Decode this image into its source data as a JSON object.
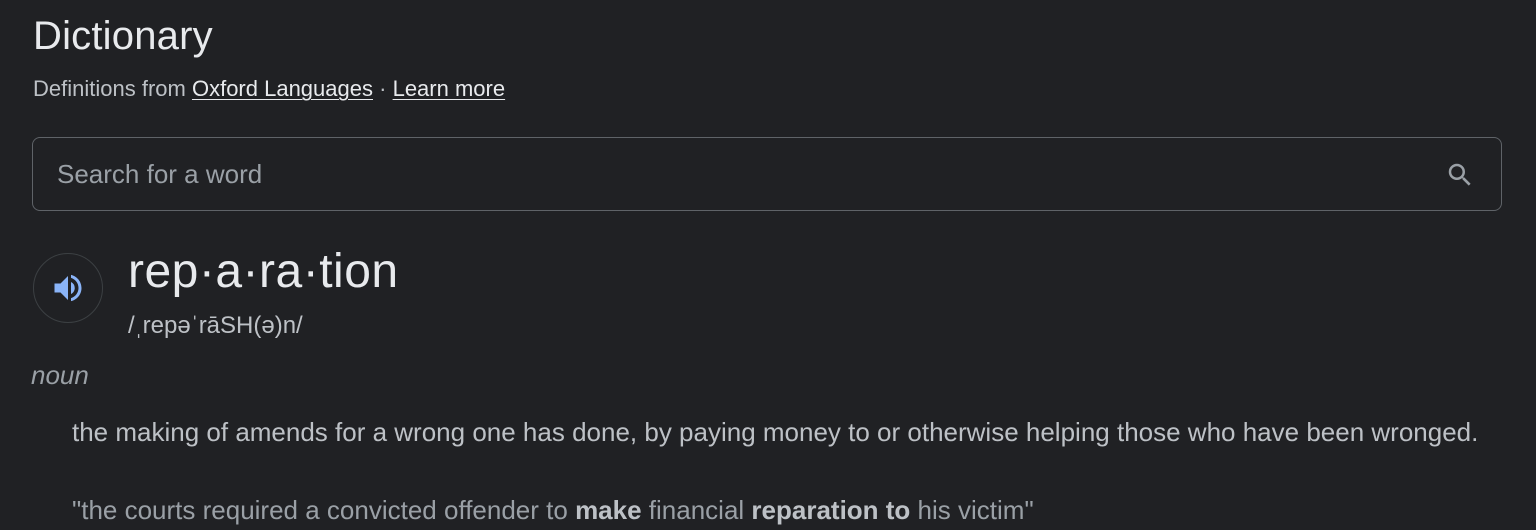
{
  "header": {
    "title": "Dictionary",
    "subtitle_prefix": "Definitions from",
    "source_link": "Oxford Languages",
    "separator": "·",
    "learn_more_link": "Learn more"
  },
  "search": {
    "placeholder": "Search for a word",
    "value": "",
    "icon": "search-icon"
  },
  "entry": {
    "speaker_icon": "speaker-icon",
    "headword": "rep·a·ra·tion",
    "pronunciation": "/ˌrepəˈrāSH(ə)n/",
    "part_of_speech": "noun",
    "definition": "the making of amends for a wrong one has done, by paying money to or otherwise helping those who have been wronged.",
    "example": {
      "open_quote": "\"the courts required a convicted offender to ",
      "bold1": "make",
      "middle": " financial ",
      "bold2": "reparation to",
      "end": " his victim\""
    }
  },
  "colors": {
    "background": "#202124",
    "text_primary": "#e8eaed",
    "text_secondary": "#bdc1c6",
    "text_muted": "#9aa0a6",
    "border": "#5f6368",
    "speaker_accent": "#8ab4f8"
  }
}
